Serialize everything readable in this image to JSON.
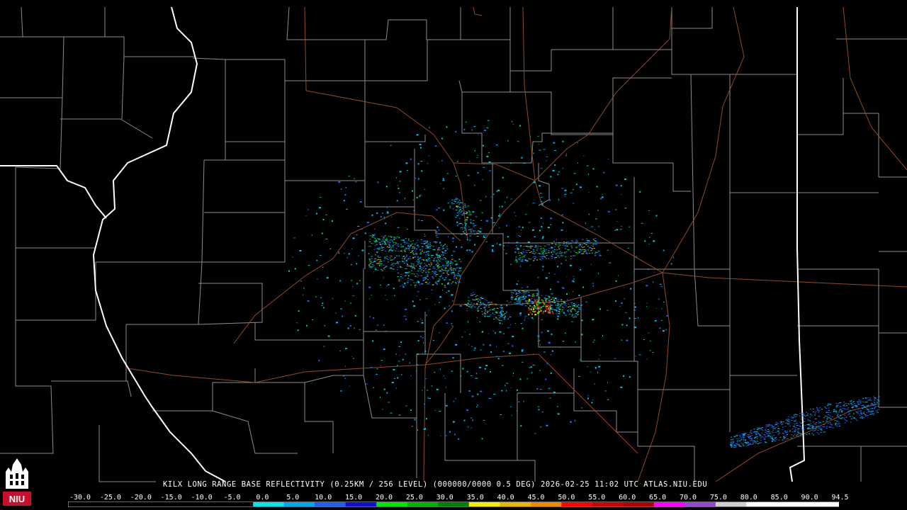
{
  "title": "KILX LONG RANGE BASE REFLECTIVITY (0.25KM / 256 LEVEL) (000000/0000 0.5 DEG) 2026-02-25 11:02 UTC  ATLAS.NIU.EDU",
  "logo": {
    "text": "NIU",
    "icon": "niu-tower-logo-icon"
  },
  "scale": {
    "labels": [
      "-30.0",
      "-25.0",
      "-20.0",
      "-15.0",
      "-10.0",
      "-5.0",
      "0.0",
      "5.0",
      "10.0",
      "15.0",
      "20.0",
      "25.0",
      "30.0",
      "35.0",
      "40.0",
      "45.0",
      "50.0",
      "55.0",
      "60.0",
      "65.0",
      "70.0",
      "75.0",
      "80.0",
      "85.0",
      "90.0",
      "94.5"
    ],
    "colors": [
      "#000000",
      "#000000",
      "#000000",
      "#000000",
      "#000000",
      "#000000",
      "#00e8e8",
      "#00a8f0",
      "#2060f0",
      "#1010d0",
      "#00e800",
      "#00b400",
      "#008000",
      "#f0f000",
      "#e8b800",
      "#f08800",
      "#ff0000",
      "#d00000",
      "#b00000",
      "#ff00ff",
      "#9848d0",
      "#d0d0d0",
      "#ffffff",
      "#ffffff",
      "#ffffff"
    ]
  }
}
